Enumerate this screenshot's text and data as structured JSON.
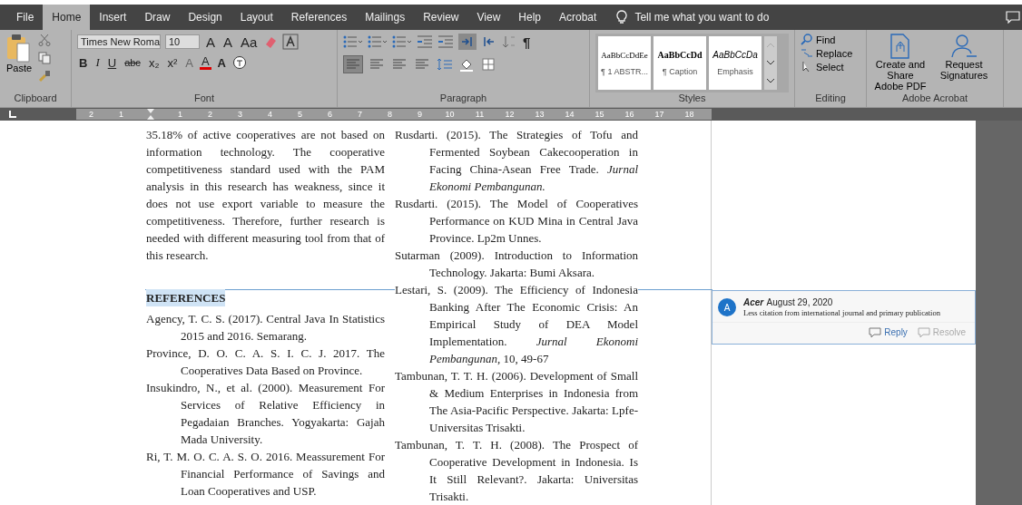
{
  "tabs": [
    {
      "label": "File",
      "selected": false
    },
    {
      "label": "Home",
      "selected": true
    },
    {
      "label": "Insert",
      "selected": false
    },
    {
      "label": "Draw",
      "selected": false
    },
    {
      "label": "Design",
      "selected": false
    },
    {
      "label": "Layout",
      "selected": false
    },
    {
      "label": "References",
      "selected": false
    },
    {
      "label": "Mailings",
      "selected": false
    },
    {
      "label": "Review",
      "selected": false
    },
    {
      "label": "View",
      "selected": false
    },
    {
      "label": "Help",
      "selected": false
    },
    {
      "label": "Acrobat",
      "selected": false
    }
  ],
  "tell_me": "Tell me what you want to do",
  "ribbon": {
    "clipboard": {
      "paste": "Paste",
      "label": "Clipboard"
    },
    "font": {
      "font_name": "Times New Roma",
      "font_size": "10",
      "size_buttons": [
        "A",
        "A",
        "Aa"
      ],
      "format_buttons": [
        {
          "text": "B",
          "kind": "bold"
        },
        {
          "text": "I",
          "kind": "italic"
        },
        {
          "text": "U",
          "kind": "underline"
        },
        {
          "text": "abc",
          "kind": "strike"
        },
        {
          "text": "x₂",
          "kind": "plain"
        },
        {
          "text": "x²",
          "kind": "plain"
        },
        {
          "text": "A",
          "kind": "faded"
        },
        {
          "text": "A",
          "kind": "red"
        },
        {
          "text": "A",
          "kind": "shaded"
        }
      ],
      "label": "Font"
    },
    "paragraph": {
      "pilcrow": "¶",
      "label": "Paragraph"
    },
    "styles": {
      "items": [
        {
          "sample": "AaBbCcDdEe",
          "name": "¶ 1 ABSTR...",
          "kind": "normal"
        },
        {
          "sample": "AaBbCcDd",
          "name": "¶ Caption",
          "kind": "bold"
        },
        {
          "sample": "AaBbCcDa",
          "name": "Emphasis",
          "kind": "italic"
        }
      ],
      "label": "Styles"
    },
    "editing": {
      "items": [
        "Find",
        "Replace",
        "Select"
      ],
      "label": "Editing"
    },
    "acrobat": {
      "items": [
        "Create and Share Adobe PDF",
        "Request Signatures"
      ],
      "label": "Adobe Acrobat"
    }
  },
  "ruler": [
    "2",
    "1",
    "1",
    "2",
    "3",
    "4",
    "5",
    "6",
    "7",
    "8",
    "9",
    "10",
    "11",
    "12",
    "13",
    "14",
    "15",
    "16",
    "17",
    "18"
  ],
  "document": {
    "left_column": [
      {
        "kind": "paragraph",
        "text": "35.18% of active cooperatives are not based on information technology. The cooperative competitiveness standard used with the PAM analysis in this research has weakness, since it does not use export variable to measure the competitiveness. Therefore, further research is needed with different measuring tool from that of this research.",
        "commented": false
      },
      {
        "kind": "heading",
        "text": "REFERENCES",
        "commented": true
      },
      {
        "kind": "reference",
        "text": "Agency, T. C. S. (2017). Central Java In Statistics  2015 and 2016. Semarang.",
        "commented": false
      },
      {
        "kind": "reference",
        "text": "Province, D. O. C. A. S. I. C. J. 2017. The Cooperatives Data Based on Province.",
        "commented": false
      },
      {
        "kind": "reference",
        "text": "Insukindro, N., et al. (2000). Measurement For Services of Relative Efficiency in Pegadaian Branches. Yogyakarta: Gajah Mada University.",
        "commented": false
      },
      {
        "kind": "reference",
        "text": "Ri, T. M. O. C. A. S. O. 2016. Meassurement For Financial Performance of Savings and Loan Cooperatives and USP.",
        "commented": false
      }
    ],
    "right_column": [
      {
        "kind": "reference",
        "text": "Rusdarti. (2015). The Strategies of Tofu and Fermented Soybean Cakecooperation in Facing China-Asean Free Trade. *Jurnal Ekonomi Pembangunan.*",
        "commented": false
      },
      {
        "kind": "reference",
        "text": "Rusdarti. (2015). The Model of Cooperatives Performance on KUD Mina in Central Java Province. Lp2m Unnes.",
        "commented": false
      },
      {
        "kind": "reference",
        "text": "Sutarman (2009). Introduction to Information Technology. Jakarta: Bumi Aksara.",
        "commented": false
      },
      {
        "kind": "reference",
        "text": "Lestari, S. (2009). The Efficiency of Indonesia Banking After The Economic Crisis: An Empirical Study of DEA Model Implementation. *Jurnal Ekonomi Pembangunan*, 10, 49-67",
        "commented": false
      },
      {
        "kind": "reference",
        "text": "Tambunan, T. T. H. (2006). Development of Small & Medium Enterprises in Indonesia from The Asia-Pacific Perspective. Jakarta: Lpfe- Universitas Trisakti.",
        "commented": false
      },
      {
        "kind": "reference",
        "text": "Tambunan, T. T. H. (2008). The Prospect of Cooperative Development in Indonesia. Is It Still Relevant?. Jakarta: Universitas Trisakti.",
        "commented": false
      }
    ]
  },
  "comment": {
    "avatar": "A",
    "author": "Acer",
    "date": "August 29, 2020",
    "text": "Less citation from international journal and primary publication",
    "actions": [
      {
        "label": "Reply",
        "disabled": false
      },
      {
        "label": "Resolve",
        "disabled": true
      }
    ]
  }
}
